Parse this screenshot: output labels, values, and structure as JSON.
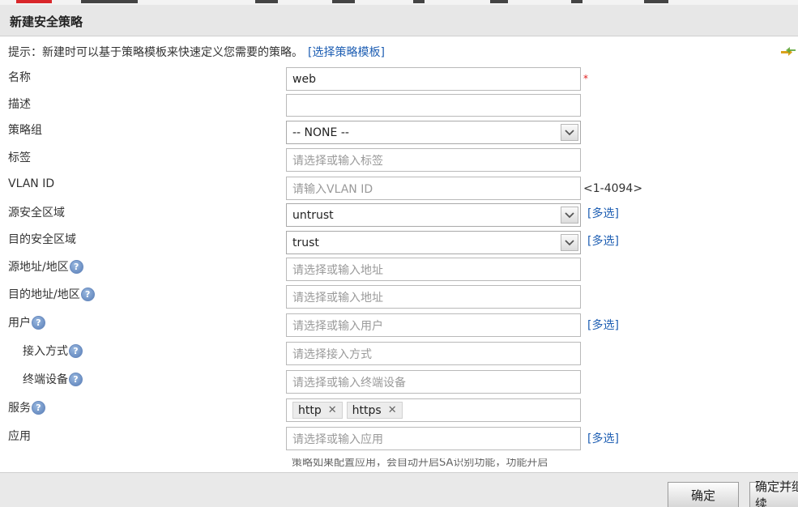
{
  "dialog": {
    "title": "新建安全策略"
  },
  "hint": {
    "text": "提示：新建时可以基于策略模板来快速定义您需要的策略。",
    "link": "[选择策略模板]"
  },
  "form": {
    "name": {
      "label": "名称",
      "value": "web",
      "required_mark": "*"
    },
    "description": {
      "label": "描述",
      "value": ""
    },
    "policy_group": {
      "label": "策略组",
      "value": "-- NONE --"
    },
    "tag": {
      "label": "标签",
      "placeholder": "请选择或输入标签"
    },
    "vlan": {
      "label": "VLAN ID",
      "placeholder": "请输入VLAN ID",
      "range": "<1-4094>"
    },
    "src_zone": {
      "label": "源安全区域",
      "value": "untrust",
      "multi": "[多选]"
    },
    "dst_zone": {
      "label": "目的安全区域",
      "value": "trust",
      "multi": "[多选]"
    },
    "src_addr": {
      "label": "源地址/地区",
      "placeholder": "请选择或输入地址"
    },
    "dst_addr": {
      "label": "目的地址/地区",
      "placeholder": "请选择或输入地址"
    },
    "user": {
      "label": "用户",
      "placeholder": "请选择或输入用户",
      "multi": "[多选]"
    },
    "access_mode": {
      "label": "接入方式",
      "placeholder": "请选择接入方式"
    },
    "terminal": {
      "label": "终端设备",
      "placeholder": "请选择或输入终端设备"
    },
    "service": {
      "label": "服务",
      "tags": [
        "http",
        "https"
      ]
    },
    "application": {
      "label": "应用",
      "placeholder": "请选择或输入应用",
      "multi": "[多选]"
    },
    "note": "策略如果配置应用，会自动开启SA识别功能，功能开启"
  },
  "help_glyph": "?",
  "remove_glyph": "✕",
  "buttons": {
    "ok": "确定",
    "ok_continue": "确定并继续"
  },
  "colors": {
    "link": "#1f5fb3",
    "required": "#e02020",
    "title_bar": "#e7e7e7",
    "footer": "#e9e9e9"
  },
  "icons": {
    "help": "help-icon",
    "dropdown": "chevron-down-icon",
    "refresh": "refresh-icon",
    "remove_tag": "close-icon"
  }
}
